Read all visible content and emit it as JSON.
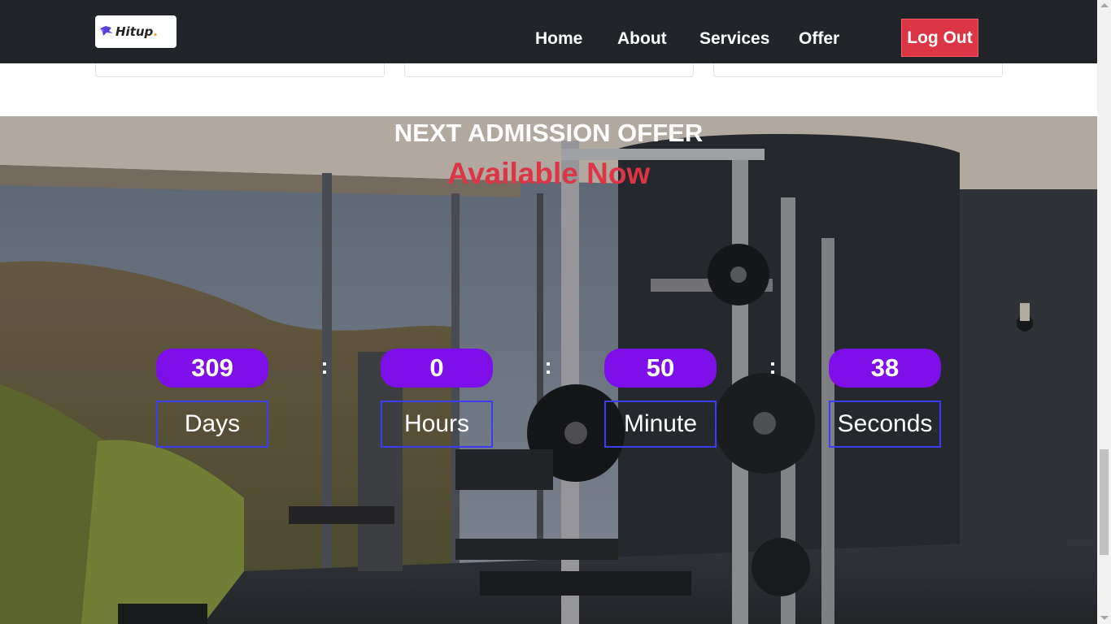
{
  "navbar": {
    "logo_text": "Hitup",
    "logo_dot": ".",
    "links": [
      {
        "label": "Home"
      },
      {
        "label": "About"
      },
      {
        "label": "Services"
      },
      {
        "label": "Offer"
      }
    ],
    "logout_label": "Log Out"
  },
  "hero": {
    "title": "NEXT ADMISSION OFFER",
    "subtitle": "Available Now",
    "countdown": [
      {
        "value": "309",
        "label": "Days"
      },
      {
        "value": "0",
        "label": "Hours"
      },
      {
        "value": "50",
        "label": "Minute"
      },
      {
        "value": "38",
        "label": "Seconds"
      }
    ],
    "separator": ":"
  },
  "colors": {
    "navbar_bg": "#212529",
    "logout_bg": "#dc3545",
    "accent_red": "#dc3545",
    "countdown_pill": "#7d10e8",
    "countdown_border": "#3d3df0"
  }
}
